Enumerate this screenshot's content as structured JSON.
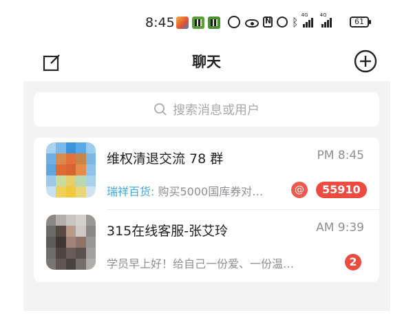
{
  "status_bar": {
    "time": "8:45",
    "battery": "61",
    "signal_label_1": "4G",
    "signal_label_2": "4G",
    "icons": [
      "app-notification-icon",
      "app-notification-icon",
      "app-notification-icon",
      "data-saver-icon",
      "eye-icon",
      "nfc-icon",
      "alarm-icon",
      "bluetooth-icon",
      "signal-icon",
      "signal-icon",
      "battery-icon"
    ]
  },
  "header": {
    "title": "聊天",
    "left_icon": "compose-icon",
    "right_icon": "add-circle-icon"
  },
  "search": {
    "placeholder": "搜索消息或用户",
    "icon": "search-icon"
  },
  "colors": {
    "accent_blue": "#3fa8e0",
    "badge_red": "#ec4b3f",
    "panel_bg": "#f3f3f4"
  },
  "chats": [
    {
      "name": "维权清退交流 78 群",
      "time": "PM 8:45",
      "sender": "瑞祥百货:",
      "message": " 购买5000国库券对…",
      "mention": "@",
      "unread": "55910"
    },
    {
      "name": "315在线客服-张艾玲",
      "time": "AM 9:39",
      "message": "学员早上好！给自己一份爱、一份温…",
      "unread": "2"
    }
  ]
}
